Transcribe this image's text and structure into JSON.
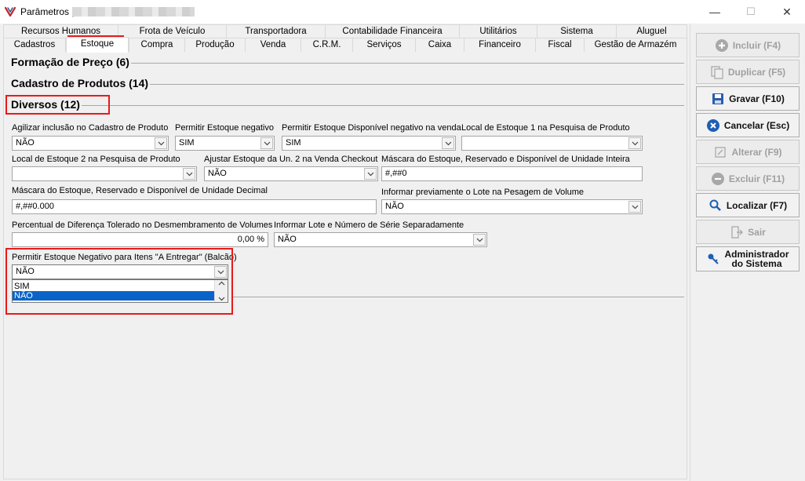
{
  "window": {
    "title": "Parâmetros |",
    "buttons": {
      "minimize": "—",
      "maximize": "☐",
      "close": "✕"
    }
  },
  "tabs": {
    "row1": [
      "Recursos Humanos",
      "Frota de Veículo",
      "Transportadora",
      "Contabilidade Financeira",
      "Utilitários",
      "Sistema",
      "Aluguel"
    ],
    "row2": [
      "Cadastros",
      "Estoque",
      "Compra",
      "Produção",
      "Venda",
      "C.R.M.",
      "Serviços",
      "Caixa",
      "Financeiro",
      "Fiscal",
      "Gestão de Armazém"
    ],
    "active": "Estoque"
  },
  "groups": {
    "formacao": "Formação de Preço (6)",
    "cadastro": "Cadastro de Produtos (14)",
    "diversos": "Diversos (12)"
  },
  "fields": {
    "agilizar": {
      "label": "Agilizar inclusão no Cadastro de Produto",
      "value": "NÃO"
    },
    "estoque_negativo": {
      "label": "Permitir Estoque negativo",
      "value": "SIM"
    },
    "estoque_disp_negativo": {
      "label": "Permitir Estoque Disponível negativo na venda",
      "value": "SIM"
    },
    "local1": {
      "label": "Local de Estoque 1 na Pesquisa de Produto",
      "value": ""
    },
    "local2": {
      "label": "Local de Estoque 2 na Pesquisa de Produto",
      "value": ""
    },
    "ajustar_un2": {
      "label": "Ajustar Estoque da Un. 2 na Venda Checkout",
      "value": "NÃO"
    },
    "mascara_inteira": {
      "label": "Máscara do Estoque, Reservado e Disponível de Unidade Inteira",
      "value": "#,##0"
    },
    "mascara_decimal": {
      "label": "Máscara do Estoque, Reservado e Disponível de Unidade Decimal",
      "value": "#,##0.000"
    },
    "informar_lote_pesagem": {
      "label": "Informar previamente o Lote na Pesagem de Volume",
      "value": "NÃO"
    },
    "percentual_diferenca": {
      "label": "Percentual de Diferença Tolerado no Desmembramento de Volumes",
      "value": "0,00 %"
    },
    "lote_serie": {
      "label": "Informar Lote e Número de Série Separadamente",
      "value": "NÃO"
    },
    "a_entregar": {
      "label": "Permitir Estoque Negativo para Itens \"A Entregar\" (Balcão)",
      "value": "NÃO",
      "options": [
        "SIM",
        "NÃO"
      ],
      "highlighted": "NÃO"
    }
  },
  "actions": {
    "incluir": "Incluir (F4)",
    "duplicar": "Duplicar (F5)",
    "gravar": "Gravar (F10)",
    "cancelar": "Cancelar (Esc)",
    "alterar": "Alterar (F9)",
    "excluir": "Excluir (F11)",
    "localizar": "Localizar (F7)",
    "sair": "Sair",
    "administrador_line1": "Administrador",
    "administrador_line2": "do Sistema"
  },
  "colors": {
    "highlight_red": "#e81a1a",
    "selection_blue": "#0a64c8",
    "cancel_icon_blue": "#1f5fb4"
  }
}
